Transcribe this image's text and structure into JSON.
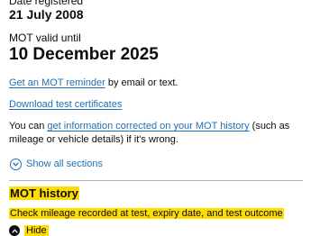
{
  "vehicle": {
    "date_registered_label": "Date registered",
    "date_registered_value": "21 July 2008",
    "mot_valid_label": "MOT valid until",
    "mot_valid_value": "10 December 2025"
  },
  "actions": {
    "reminder_link": "Get an MOT reminder",
    "reminder_suffix": " by email or text.",
    "certificates_link": "Download test certificates",
    "correction_prefix": "You can ",
    "correction_link": "get information corrected on your MOT history",
    "correction_suffix": " (such as mileage or vehicle details) if it's wrong."
  },
  "accordion": {
    "show_all_label": "Show all sections",
    "section_title": "MOT history",
    "section_summary": "Check mileage recorded at test, expiry date, and test outcome",
    "hide_label": "Hide"
  },
  "colors": {
    "link": "#1d70b8",
    "focus_highlight": "#ffdd00",
    "text": "#0b0c0c"
  },
  "icons": {
    "show_all": "chevron-down-circle-icon",
    "hide": "chevron-up-circle-icon"
  }
}
